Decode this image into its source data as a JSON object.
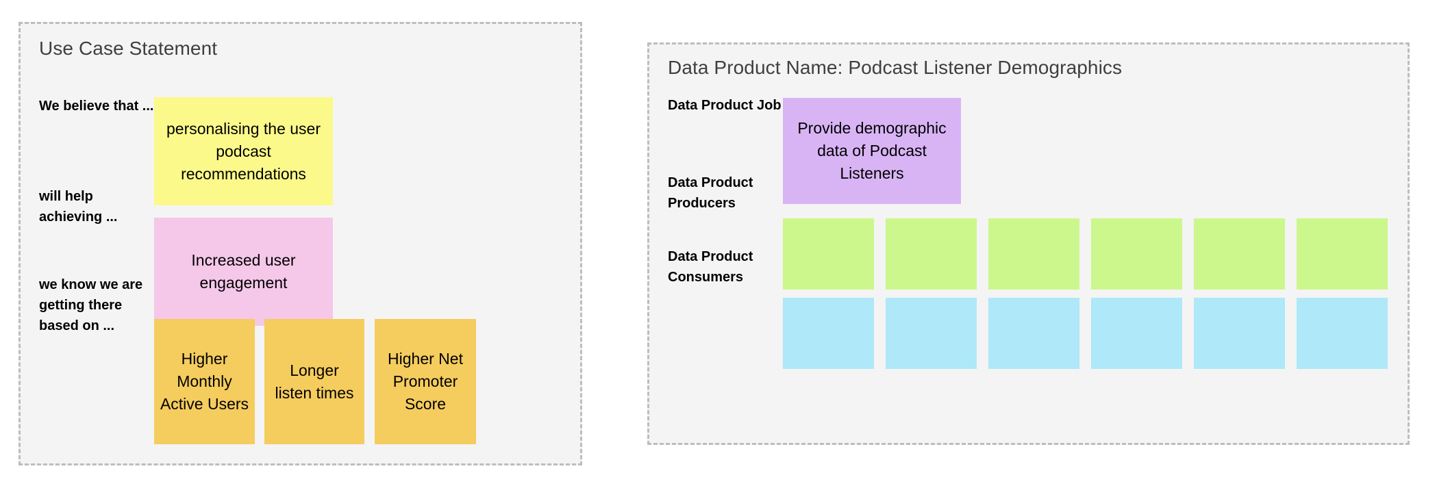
{
  "left_panel": {
    "title": "Use Case Statement",
    "rows": [
      {
        "label": "We believe that ...",
        "notes": [
          {
            "text": "personalising the user podcast recommendations",
            "color": "#fbf98a"
          }
        ]
      },
      {
        "label": "will help achieving ...",
        "notes": [
          {
            "text": "Increased user engagement",
            "color": "#f5c7e9"
          }
        ]
      },
      {
        "label": "we know we are getting there based on ...",
        "notes": [
          {
            "text": "Higher Monthly Active Users",
            "color": "#f5cc5e"
          },
          {
            "text": "Longer listen times",
            "color": "#f5cc5e"
          },
          {
            "text": "Higher Net Promoter Score",
            "color": "#f5cc5e"
          }
        ]
      }
    ]
  },
  "right_panel": {
    "title": "Data Product Name: Podcast Listener Demographics",
    "rows": [
      {
        "label": "Data Product Job",
        "notes": [
          {
            "text": "Provide demographic data of Podcast Listeners",
            "color": "#d8b4f5"
          }
        ]
      },
      {
        "label": "Data Product Producers",
        "notes": [
          {
            "text": "",
            "color": "#ccf78c"
          },
          {
            "text": "",
            "color": "#ccf78c"
          },
          {
            "text": "",
            "color": "#ccf78c"
          },
          {
            "text": "",
            "color": "#ccf78c"
          },
          {
            "text": "",
            "color": "#ccf78c"
          },
          {
            "text": "",
            "color": "#ccf78c"
          }
        ]
      },
      {
        "label": "Data Product Consumers",
        "notes": [
          {
            "text": "",
            "color": "#aee8f9"
          },
          {
            "text": "",
            "color": "#aee8f9"
          },
          {
            "text": "",
            "color": "#aee8f9"
          },
          {
            "text": "",
            "color": "#aee8f9"
          },
          {
            "text": "",
            "color": "#aee8f9"
          },
          {
            "text": "",
            "color": "#aee8f9"
          }
        ]
      }
    ]
  },
  "colors": {
    "panel_background": "#f4f4f4",
    "panel_border": "#bdbdbd",
    "title_text": "#3f3f3f",
    "body_text": "#000000",
    "yellow": "#fbf98a",
    "pink": "#f5c7e9",
    "orange": "#f5cc5e",
    "purple": "#d8b4f5",
    "green": "#ccf78c",
    "blue": "#aee8f9"
  }
}
